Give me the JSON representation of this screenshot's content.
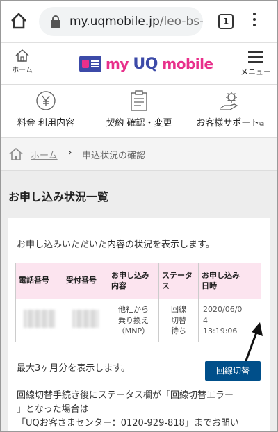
{
  "browser": {
    "url_host": "my.uqmobile.jp",
    "url_path": "/leo-bs-|",
    "tab_count": "1"
  },
  "header": {
    "home_label": "ホーム",
    "logo_my": "my",
    "logo_uq": "UQ",
    "logo_mobile": "mobile",
    "menu_label": "メニュー"
  },
  "nav": {
    "items": [
      {
        "label": "料金 利用内容",
        "icon": "yen-coin-icon"
      },
      {
        "label": "契約 確認・変更",
        "icon": "clipboard-icon"
      },
      {
        "label": "お客様サポート",
        "icon": "support-gear-hand-icon"
      }
    ],
    "external_mark": "⧉"
  },
  "breadcrumb": {
    "home": "ホーム",
    "separator": "›",
    "current": "申込状況の確認"
  },
  "page": {
    "title": "お申し込み状況一覧",
    "intro": "お申し込みいただいた内容の状況を表示します。",
    "table": {
      "headers": [
        "電話番号",
        "受付番号",
        "お申し込み内容",
        "ステータス",
        "お申し込み日時"
      ],
      "rows": [
        {
          "content_lines": [
            "他社から",
            "乗り換え",
            "（MNP）"
          ],
          "status_lines": [
            "回線",
            "切替",
            "待ち"
          ],
          "date_lines": [
            "2020/06/0",
            "4",
            "13:19:06"
          ]
        }
      ]
    },
    "max_note": "最大3ヶ月分を表示します。",
    "switch_button": "回線切替",
    "info_lines": [
      "回線切替手続き後にステータス欄が「回線切替エラー",
      "」となった場合は",
      "「UQお客さまセンター：0120-929-818」までお問い"
    ]
  }
}
